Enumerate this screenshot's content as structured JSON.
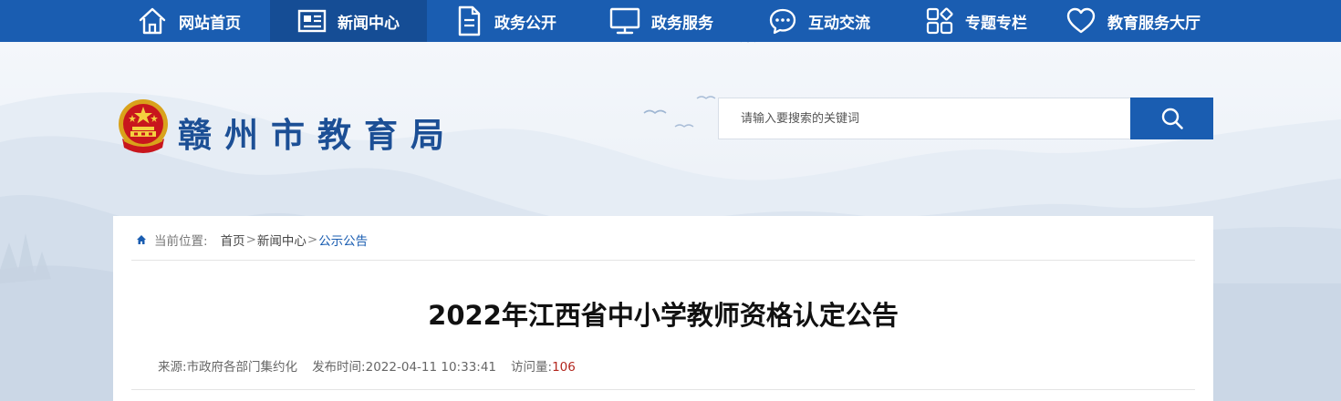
{
  "nav": {
    "items": [
      {
        "label": "网站首页",
        "icon": "home-icon"
      },
      {
        "label": "新闻中心",
        "icon": "newspaper-icon",
        "active": true
      },
      {
        "label": "政务公开",
        "icon": "document-icon"
      },
      {
        "label": "政务服务",
        "icon": "monitor-icon"
      },
      {
        "label": "互动交流",
        "icon": "chat-icon"
      },
      {
        "label": "专题专栏",
        "icon": "grid-icon"
      },
      {
        "label": "教育服务大厅",
        "icon": "heart-icon"
      }
    ]
  },
  "header": {
    "site_title": "赣州市教育局",
    "emblem": "national-emblem-icon"
  },
  "search": {
    "placeholder": "请输入要搜索的关键词",
    "button_icon": "search-icon"
  },
  "breadcrumb": {
    "label": "当前位置:",
    "items": [
      "首页",
      "新闻中心",
      "公示公告"
    ],
    "separator": ">"
  },
  "article": {
    "title": "2022年江西省中小学教师资格认定公告",
    "source_label": "来源:",
    "source": "市政府各部门集约化",
    "published_label": "发布时间:",
    "published": "2022-04-11 10:33:41",
    "views_label": "访问量:",
    "views": "106"
  },
  "colors": {
    "nav_bg": "#1a5db1",
    "nav_active_bg": "#154d95",
    "title_blue": "#1c4f95",
    "views_red": "#b3261e"
  }
}
